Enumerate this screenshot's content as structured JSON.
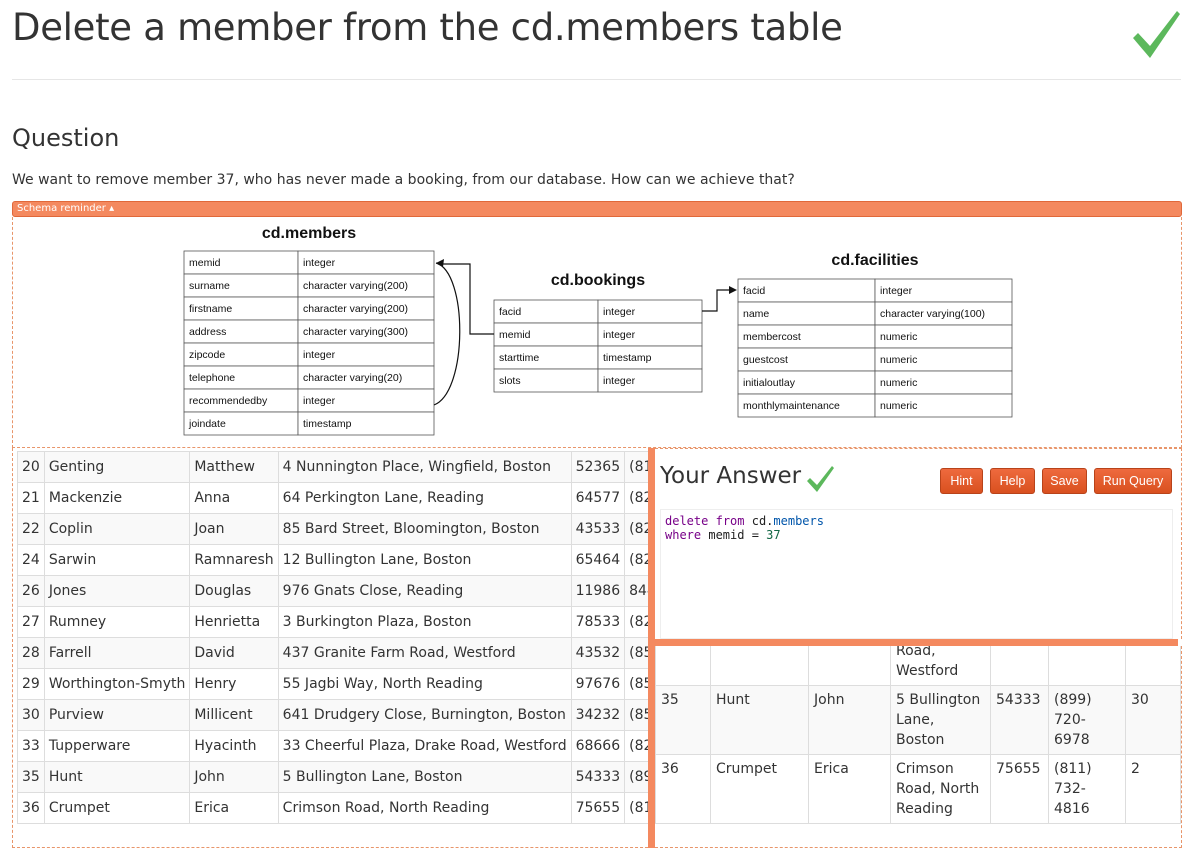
{
  "page": {
    "title": "Delete a member from the cd.members table"
  },
  "question": {
    "heading": "Question",
    "text": "We want to remove member 37, who has never made a booking, from our database. How can we achieve that?"
  },
  "schema": {
    "toggle_label": "Schema reminder ▴",
    "tables": [
      {
        "name": "cd.members",
        "rows": [
          [
            "memid",
            "integer"
          ],
          [
            "surname",
            "character varying(200)"
          ],
          [
            "firstname",
            "character varying(200)"
          ],
          [
            "address",
            "character varying(300)"
          ],
          [
            "zipcode",
            "integer"
          ],
          [
            "telephone",
            "character varying(20)"
          ],
          [
            "recommendedby",
            "integer"
          ],
          [
            "joindate",
            "timestamp"
          ]
        ]
      },
      {
        "name": "cd.bookings",
        "rows": [
          [
            "facid",
            "integer"
          ],
          [
            "memid",
            "integer"
          ],
          [
            "starttime",
            "timestamp"
          ],
          [
            "slots",
            "integer"
          ]
        ]
      },
      {
        "name": "cd.facilities",
        "rows": [
          [
            "facid",
            "integer"
          ],
          [
            "name",
            "character varying(100)"
          ],
          [
            "membercost",
            "numeric"
          ],
          [
            "guestcost",
            "numeric"
          ],
          [
            "initialoutlay",
            "numeric"
          ],
          [
            "monthlymaintenance",
            "numeric"
          ]
        ]
      }
    ]
  },
  "results_left": [
    [
      "20",
      "Genting",
      "Matthew",
      "4 Nunnington Place, Wingfield, Boston",
      "52365",
      "(81"
    ],
    [
      "21",
      "Mackenzie",
      "Anna",
      "64 Perkington Lane, Reading",
      "64577",
      "(82"
    ],
    [
      "22",
      "Coplin",
      "Joan",
      "85 Bard Street, Bloomington, Boston",
      "43533",
      "(82"
    ],
    [
      "24",
      "Sarwin",
      "Ramnaresh",
      "12 Bullington Lane, Boston",
      "65464",
      "(82"
    ],
    [
      "26",
      "Jones",
      "Douglas",
      "976 Gnats Close, Reading",
      "11986",
      "844"
    ],
    [
      "27",
      "Rumney",
      "Henrietta",
      "3 Burkington Plaza, Boston",
      "78533",
      "(82"
    ],
    [
      "28",
      "Farrell",
      "David",
      "437 Granite Farm Road, Westford",
      "43532",
      "(85"
    ],
    [
      "29",
      "Worthington-Smyth",
      "Henry",
      "55 Jagbi Way, North Reading",
      "97676",
      "(85"
    ],
    [
      "30",
      "Purview",
      "Millicent",
      "641 Drudgery Close, Burnington, Boston",
      "34232",
      "(85"
    ],
    [
      "33",
      "Tupperware",
      "Hyacinth",
      "33 Cheerful Plaza, Drake Road, Westford",
      "68666",
      "(82"
    ],
    [
      "35",
      "Hunt",
      "John",
      "5 Bullington Lane, Boston",
      "54333",
      "(89"
    ],
    [
      "36",
      "Crumpet",
      "Erica",
      "Crimson Road, North Reading",
      "75655",
      "(81"
    ]
  ],
  "answer": {
    "heading": "Your Answer",
    "buttons": {
      "hint": "Hint",
      "help": "Help",
      "save": "Save",
      "run": "Run Query"
    },
    "query_lines": [
      [
        [
          "kw",
          "delete"
        ],
        [
          "plain",
          " "
        ],
        [
          "kw",
          "from"
        ],
        [
          "plain",
          " cd."
        ],
        [
          "prop",
          "members"
        ]
      ],
      [
        [
          "kw",
          "where"
        ],
        [
          "plain",
          " memid = "
        ],
        [
          "num",
          "37"
        ]
      ]
    ]
  },
  "results_right": [
    [
      "",
      "",
      "",
      "Road, Westford",
      "",
      "",
      ""
    ],
    [
      "35",
      "Hunt",
      "John",
      "5 Bullington Lane, Boston",
      "54333",
      "(899) 720-6978",
      "30"
    ],
    [
      "36",
      "Crumpet",
      "Erica",
      "Crimson Road, North Reading",
      "75655",
      "(811) 732-4816",
      "2"
    ]
  ],
  "colors": {
    "accent": "#f4895f",
    "button": "#e05a2b",
    "check": "#5cb85c"
  }
}
